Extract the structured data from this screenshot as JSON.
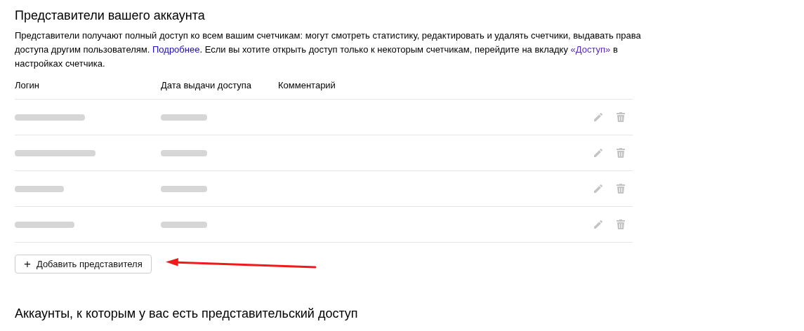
{
  "section_title": "Представители вашего аккаунта",
  "description": "Представители получают полный доступ ко всем вашим счетчикам: могут смотреть статистику, редактировать и удалять счетчики, выдавать права доступа другим пользователям. ",
  "description_link": "Подробнее",
  "description_rest": ". Если вы хотите открыть доступ только к некоторым счетчикам, перейдите на вкладку ",
  "description_link_2": "«Доступ»",
  "description_end": " в настройках счетчика.",
  "table": {
    "columns": [
      "Логин",
      "Дата выдачи доступа",
      "Комментарий"
    ],
    "rows": [
      {
        "kind": "redacted"
      },
      {
        "kind": "redacted"
      },
      {
        "kind": "redacted"
      },
      {
        "kind": "redacted"
      }
    ]
  },
  "add_button": {
    "icon": "+",
    "label": "Добавить представителя"
  },
  "annotation_arrow": {
    "color": "#f01a1a"
  },
  "second_section_title": "Аккаунты, к которым у вас есть представительский доступ"
}
